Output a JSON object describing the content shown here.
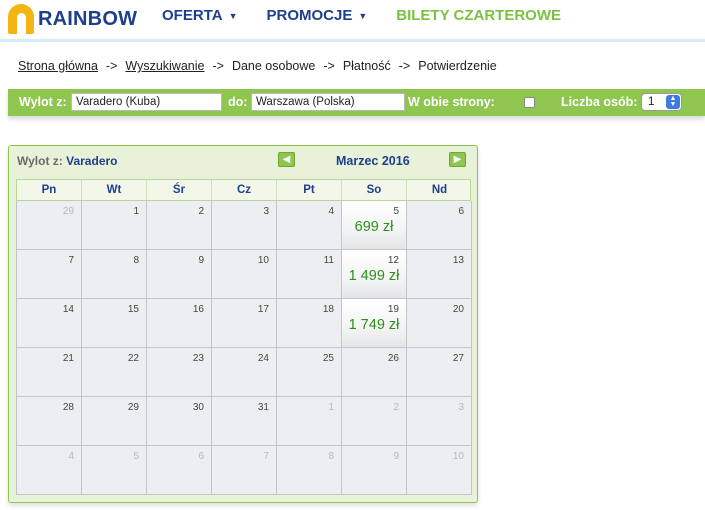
{
  "brand": {
    "name": "RAINBOW",
    "logo_color": "#f3b514",
    "text_color": "#1d3f8c"
  },
  "nav": [
    {
      "label": "OFERTA",
      "dropdown": true
    },
    {
      "label": "PROMOCJE",
      "dropdown": true
    },
    {
      "label": "BILETY CZARTEROWE",
      "dropdown": false,
      "active": true
    }
  ],
  "breadcrumb": {
    "items": [
      "Strona główna",
      "Wyszukiwanie",
      "Dane osobowe",
      "Płatność",
      "Potwierdzenie"
    ],
    "separator": "->"
  },
  "search": {
    "from_label": "Wylot z:",
    "from_value": "Varadero (Kuba)",
    "to_label": "do:",
    "to_value": "Warszawa (Polska)",
    "roundtrip_label": "W obie strony:",
    "roundtrip_checked": false,
    "persons_label": "Liczba osób:",
    "persons_value": "1",
    "bar_color": "#8fc64f"
  },
  "calendar": {
    "title_prefix": "Wylot z:",
    "city": "Varadero",
    "month": "Marzec 2016",
    "prev_icon": "arrow-left-icon",
    "next_icon": "arrow-right-icon",
    "weekdays": [
      "Pn",
      "Wt",
      "Śr",
      "Cz",
      "Pt",
      "So",
      "Nd"
    ],
    "weeks": [
      [
        {
          "d": "29",
          "other": true
        },
        {
          "d": "1"
        },
        {
          "d": "2"
        },
        {
          "d": "3"
        },
        {
          "d": "4"
        },
        {
          "d": "5",
          "price": "699 zł"
        },
        {
          "d": "6"
        }
      ],
      [
        {
          "d": "7"
        },
        {
          "d": "8"
        },
        {
          "d": "9"
        },
        {
          "d": "10"
        },
        {
          "d": "11"
        },
        {
          "d": "12",
          "price": "1 499 zł"
        },
        {
          "d": "13"
        }
      ],
      [
        {
          "d": "14"
        },
        {
          "d": "15"
        },
        {
          "d": "16"
        },
        {
          "d": "17"
        },
        {
          "d": "18"
        },
        {
          "d": "19",
          "price": "1 749 zł"
        },
        {
          "d": "20"
        }
      ],
      [
        {
          "d": "21"
        },
        {
          "d": "22"
        },
        {
          "d": "23"
        },
        {
          "d": "24"
        },
        {
          "d": "25"
        },
        {
          "d": "26"
        },
        {
          "d": "27"
        }
      ],
      [
        {
          "d": "28"
        },
        {
          "d": "29"
        },
        {
          "d": "30"
        },
        {
          "d": "31"
        },
        {
          "d": "1",
          "other": true
        },
        {
          "d": "2",
          "other": true
        },
        {
          "d": "3",
          "other": true
        }
      ],
      [
        {
          "d": "4",
          "other": true
        },
        {
          "d": "5",
          "other": true
        },
        {
          "d": "6",
          "other": true
        },
        {
          "d": "7",
          "other": true
        },
        {
          "d": "8",
          "other": true
        },
        {
          "d": "9",
          "other": true
        },
        {
          "d": "10",
          "other": true
        }
      ]
    ],
    "price_color": "#2f8f1a"
  }
}
